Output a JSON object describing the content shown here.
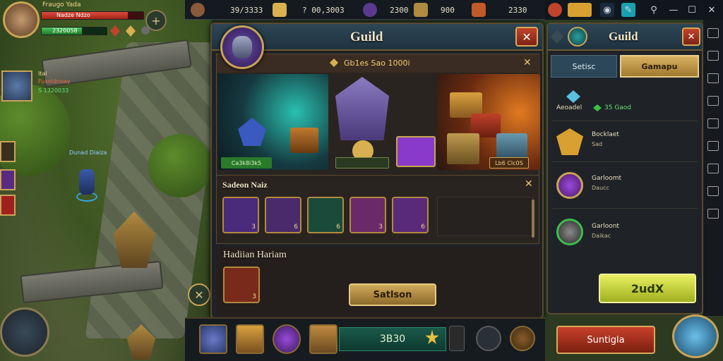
{
  "player": {
    "name": "Fraugo Yada",
    "title_bar": "Nadze Ndzo",
    "energy": "2320058",
    "health_fraction": 0.85,
    "mana_fraction": 0.62
  },
  "ally": {
    "name": "Ital",
    "sub": "Fuxoldnoay",
    "stat": "S 1320033"
  },
  "npc_name": "Dunad Diaiza",
  "resources": [
    {
      "icon": "portrait-icon",
      "value": "39/3333"
    },
    {
      "icon": "gold-bar-icon",
      "value": "? 00,3003"
    },
    {
      "icon": "mask-icon",
      "value": "2300"
    },
    {
      "icon": "crate-icon",
      "value": "900"
    },
    {
      "icon": "chest-icon",
      "value": "2330"
    }
  ],
  "colors": {
    "accent": "#c9a357",
    "green": "#3aa84a",
    "danger": "#c0432c",
    "panel": "#1f2226"
  },
  "guild": {
    "title": "Guild",
    "close": "✕",
    "offer_title": "Gb1es Sao 1000i",
    "offer_close": "✕",
    "tags": [
      "Ca3k8i3k5",
      "Lb6 CIc0S"
    ],
    "items_title": "Sadeon Naiz",
    "items_close": "✕",
    "slots": [
      {
        "icon": "shuriken-icon",
        "level": "3"
      },
      {
        "icon": "amulet-icon",
        "level": "6"
      },
      {
        "icon": "dagger-icon",
        "level": "6"
      },
      {
        "icon": "axe-icon",
        "level": "3"
      },
      {
        "icon": "scroll-icon",
        "level": "6"
      }
    ],
    "reward_title": "Hadiian Hariam",
    "reward_slot_level": "3",
    "button": "Satlson"
  },
  "side": {
    "title": "Guild",
    "close": "✕",
    "tabs": [
      "Setisc",
      "Gamapu"
    ],
    "rows": [
      {
        "icon": "gem-icon",
        "text": "Aeoadel",
        "extra": "35 Gaod"
      },
      {
        "icon": "lion-emblem-icon",
        "text": "Bocklaet",
        "sub": "Sad"
      },
      {
        "icon": "violet-gem-icon",
        "text": "Garloomt",
        "sub": "Daucc"
      },
      {
        "icon": "armor-icon",
        "text": "Garloont",
        "sub": "Daikac"
      }
    ],
    "action_button": "2udX",
    "bottom_button": "Suntigla"
  },
  "bottom": {
    "counter": "3B30",
    "slots": [
      "avatar-icon",
      "crate-icon",
      "gem-ring-icon",
      "chest-icon"
    ]
  },
  "window": {
    "minimize": "—",
    "restore": "☐",
    "close": "✕"
  }
}
